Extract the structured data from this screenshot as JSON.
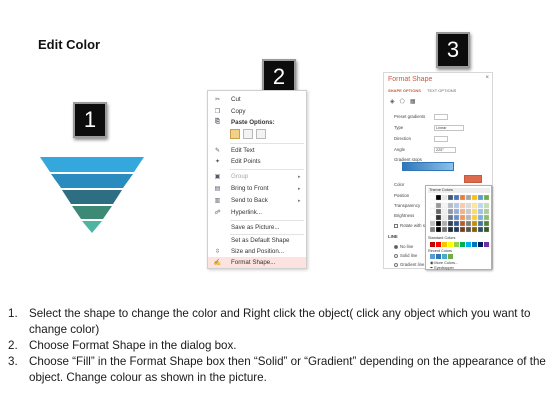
{
  "title": "Edit Color",
  "steps": [
    "1",
    "2",
    "3"
  ],
  "context_menu": {
    "items": [
      {
        "icon": "cut-icon",
        "glyph": "✂",
        "label": "Cut",
        "arrow": "",
        "disabled": false
      },
      {
        "icon": "copy-icon",
        "glyph": "❐",
        "label": "Copy",
        "arrow": "",
        "disabled": false
      },
      {
        "icon": "paste-icon",
        "glyph": "⎘",
        "label": "Paste Options:",
        "arrow": "",
        "disabled": false,
        "bold": true
      },
      {
        "icon": "edit-text-icon",
        "glyph": "✎",
        "label": "Edit Text",
        "arrow": "",
        "disabled": false
      },
      {
        "icon": "edit-points-icon",
        "glyph": "✦",
        "label": "Edit Points",
        "arrow": "",
        "disabled": false
      },
      {
        "icon": "group-icon",
        "glyph": "▣",
        "label": "Group",
        "arrow": "▸",
        "disabled": true
      },
      {
        "icon": "bring-to-front-icon",
        "glyph": "▤",
        "label": "Bring to Front",
        "arrow": "▸",
        "disabled": false
      },
      {
        "icon": "send-to-back-icon",
        "glyph": "▥",
        "label": "Send to Back",
        "arrow": "▸",
        "disabled": false
      },
      {
        "icon": "hyperlink-icon",
        "glyph": "☍",
        "label": "Hyperlink...",
        "arrow": "",
        "disabled": false
      },
      {
        "icon": "save-as-picture-icon",
        "glyph": "",
        "label": "Save as Picture...",
        "arrow": "",
        "disabled": false
      },
      {
        "icon": "default-shape-icon",
        "glyph": "",
        "label": "Set as Default Shape",
        "arrow": "",
        "disabled": false
      },
      {
        "icon": "size-position-icon",
        "glyph": "⇳",
        "label": "Size and Position...",
        "arrow": "",
        "disabled": false
      },
      {
        "icon": "format-shape-icon",
        "glyph": "✍",
        "label": "Format Shape...",
        "arrow": "",
        "disabled": false,
        "hover": true
      }
    ]
  },
  "format_shape": {
    "title": "Format Shape",
    "close": "×",
    "tab_shape": "SHAPE OPTIONS",
    "tab_text": "TEXT OPTIONS",
    "rows": [
      {
        "label": "Preset gradients",
        "value": ""
      },
      {
        "label": "Type",
        "value": "Linear"
      },
      {
        "label": "Direction",
        "value": ""
      },
      {
        "label": "Angle",
        "value": "225°"
      },
      {
        "label": "Gradient stops",
        "value": ""
      },
      {
        "label": "Color",
        "value": ""
      },
      {
        "label": "Position",
        "value": ""
      },
      {
        "label": "Transparency",
        "value": ""
      },
      {
        "label": "Brightness",
        "value": ""
      },
      {
        "label": "Rotate with shape",
        "value": ""
      }
    ],
    "line_section": "LINE",
    "line_options": [
      "No line",
      "Solid line",
      "Gradient line"
    ]
  },
  "color_picker": {
    "theme_label": "Theme Colors",
    "standard_label": "Standard Colors",
    "recent_label": "Recent Colors",
    "more_colors": "More Colors...",
    "eyedropper": "Eyedropper",
    "theme_colors": [
      "#ffffff",
      "#000000",
      "#e7e6e6",
      "#44546a",
      "#4472c4",
      "#ed7d31",
      "#a5a5a5",
      "#ffc000",
      "#5b9bd5",
      "#70ad47"
    ],
    "standard_colors": [
      "#c00000",
      "#ff0000",
      "#ffc000",
      "#ffff00",
      "#92d050",
      "#00b050",
      "#00b0f0",
      "#0070c0",
      "#002060",
      "#7030a0"
    ],
    "recent_colors": [
      "#5b9bd5",
      "#2f76b8",
      "#4bacc6",
      "#70ad47"
    ]
  },
  "pyramid_colors": [
    "#34a7dd",
    "#2a8bbf",
    "#2e6e82",
    "#3c8a76",
    "#4db5a2"
  ],
  "instructions": [
    {
      "n": "1.",
      "text": "Select the shape to change the color and Right click the object( click any object which you want to change color)"
    },
    {
      "n": "2.",
      "text": "Choose Format Shape in the dialog box."
    },
    {
      "n": "3.",
      "text": "Choose “Fill” in the Format Shape box then “Solid” or “Gradient” depending on the appearance of the object. Change colour as shown in the picture."
    }
  ]
}
